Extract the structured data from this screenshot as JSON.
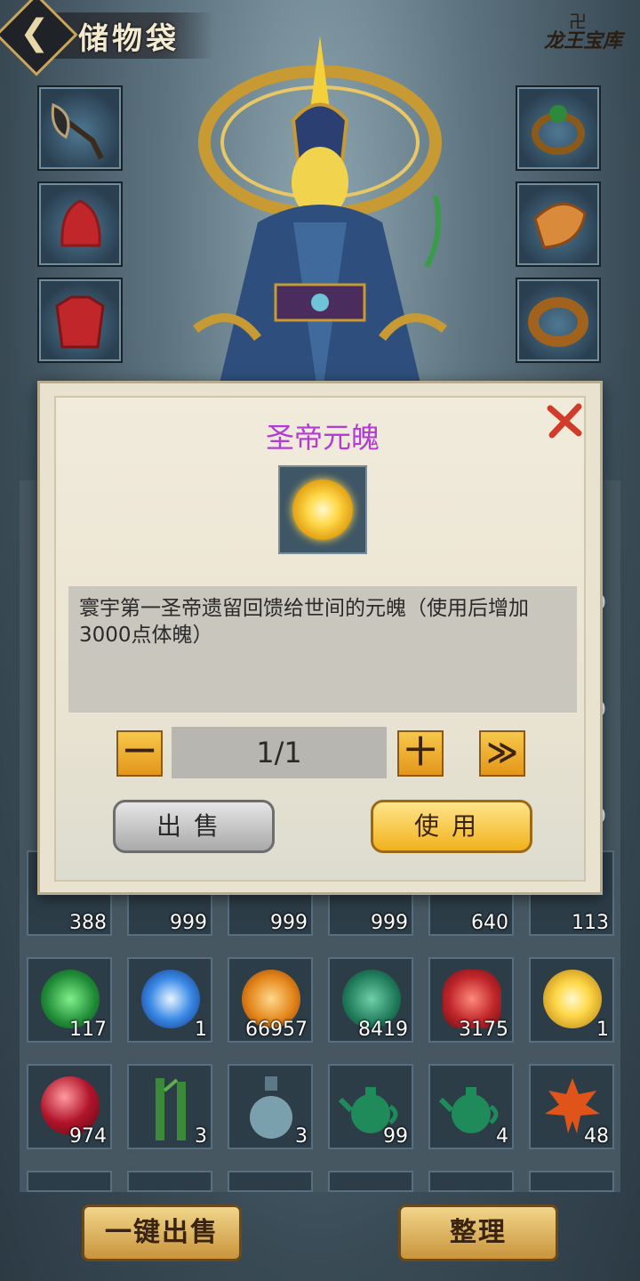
{
  "header": {
    "back_icon": "chevron-left-icon",
    "title": "储物袋",
    "logo_text": "龙王宝库"
  },
  "equipment": {
    "left": [
      "axe-weapon",
      "red-helmet",
      "red-armor",
      "item-slot"
    ],
    "right": [
      "jade-ring",
      "jade-pendant",
      "bronze-bracelet",
      "item-slot"
    ]
  },
  "inventory": {
    "row1_counts": [
      "388",
      "999",
      "999",
      "999",
      "640",
      "113"
    ],
    "row2": [
      {
        "icon": "green-gem-icon",
        "count": "117"
      },
      {
        "icon": "blue-energy-orb-icon",
        "count": "1"
      },
      {
        "icon": "amber-gem-icon",
        "count": "66957"
      },
      {
        "icon": "jade-stone-icon",
        "count": "8419"
      },
      {
        "icon": "red-gift-bag-icon",
        "count": "3175"
      },
      {
        "icon": "golden-orb-icon",
        "count": "1"
      }
    ],
    "row3": [
      {
        "icon": "red-pearl-icon",
        "count": "974"
      },
      {
        "icon": "bamboo-icon",
        "count": "3"
      },
      {
        "icon": "gourd-vase-icon",
        "count": "3"
      },
      {
        "icon": "green-teapot-icon",
        "count": "99"
      },
      {
        "icon": "green-teapot-icon",
        "count": "4"
      },
      {
        "icon": "maple-leaf-icon",
        "count": "48"
      }
    ],
    "partial_count_right": [
      "9",
      "9",
      "9"
    ]
  },
  "dialog": {
    "title": "圣帝元魄",
    "item_icon": "golden-orb-icon",
    "description": "寰宇第一圣帝遗留回馈给世间的元魄（使用后增加3000点体魄）",
    "minus_label": "一",
    "quantity": "1/1",
    "plus_label": "十",
    "max_label": "≫",
    "sell_label": "出售",
    "use_label": "使用"
  },
  "footer": {
    "quick_sell_label": "一键出售",
    "sort_label": "整理"
  },
  "colors": {
    "title_purple": "#b23ad6",
    "gold_button": "#f1b21d",
    "close_red": "#d23a2a"
  }
}
